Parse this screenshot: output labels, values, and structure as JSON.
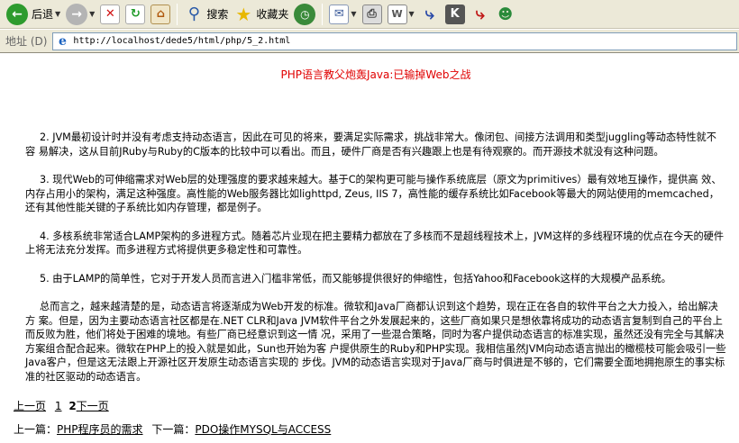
{
  "toolbar": {
    "back_label": "后退",
    "search_label": "搜索",
    "favorites_label": "收藏夹"
  },
  "address": {
    "label": "地址 (D)",
    "url": "http://localhost/dede5/html/php/5_2.html"
  },
  "article": {
    "title": "PHP语言教父炮轰Java:已输掉Web之战",
    "paragraphs": [
      "2. JVM最初设计时并没有考虑支持动态语言，因此在可见的将来，要满足实际需求，挑战非常大。像闭包、间接方法调用和类型juggling等动态特性就不容 易解决，这从目前JRuby与Ruby的C版本的比较中可以看出。而且，硬件厂商是否有兴趣跟上也是有待观察的。而开源技术就没有这种问题。",
      "3. 现代Web的可伸缩需求对Web层的处理强度的要求越来越大。基于C的架构更可能与操作系统底层（原文为primitives）最有效地互操作，提供高 效、内存占用小的架构，满足这种强度。高性能的Web服务器比如lighttpd, Zeus, IIS 7，高性能的缓存系统比如Facebook等最大的网站使用的memcached，还有其他性能关键的子系统比如内存管理，都是例子。",
      "4. 多核系统非常适合LAMP架构的多进程方式。随着芯片业现在把主要精力都放在了多核而不是超线程技术上，JVM这样的多线程环境的优点在今天的硬件上将无法充分发挥。而多进程方式将提供更多稳定性和可靠性。",
      "5. 由于LAMP的简单性，它对于开发人员而言进入门槛非常低，而又能够提供很好的伸缩性，包括Yahoo和Facebook这样的大规模产品系统。",
      "总而言之，越来越清楚的是，动态语言将逐渐成为Web开发的标准。微软和Java厂商都认识到这个趋势，现在正在各自的软件平台之大力投入，给出解决方 案。但是，因为主要动态语言社区都是在.NET CLR和Java JVM软件平台之外发展起来的，这些厂商如果只是想依靠将成功的动态语言复制到自己的平台上而反败为胜，他们将处于困难的境地。有些厂商已经意识到这一情 况，采用了一些混合策略，同时为客户提供动态语言的标准实现，虽然还没有完全与其解决方案组合配合起来。微软在PHP上的投入就是如此，Sun也开始为客 户提供原生的Ruby和PHP实现。我相信虽然JVM向动态语言抛出的橄榄枝可能会吸引一些Java客户，但是这无法跟上开源社区开发原生动态语言实现的 步伐。JVM的动态语言实现对于Java厂商与时俱进是不够的，它们需要全面地拥抱原生的事实标准的社区驱动的动态语言。"
    ]
  },
  "pager": {
    "prev": "上一页",
    "page1": "1",
    "page2": "2",
    "next": "下一页"
  },
  "nav": {
    "prev_label": "上一篇：",
    "prev_link": "PHP程序员的需求",
    "next_label": "下一篇：",
    "next_link": "PDO操作MYSQL与ACCESS"
  }
}
